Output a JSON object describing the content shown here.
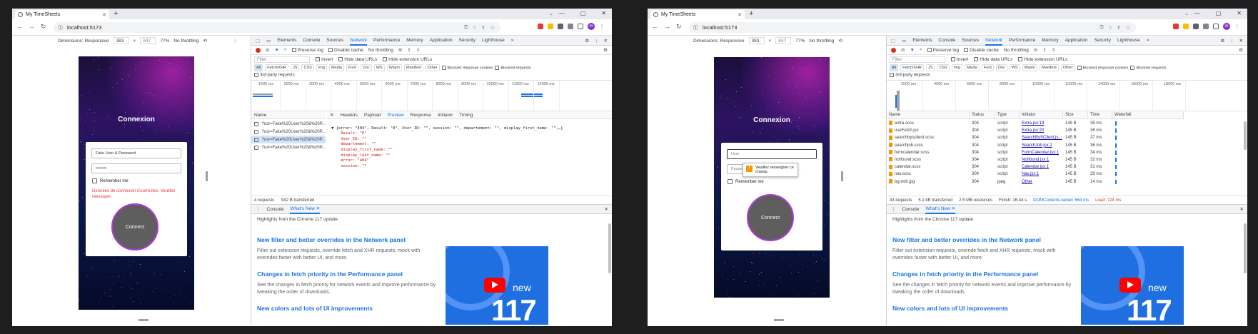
{
  "window_left": {
    "tab_title": "My TimeSheets",
    "url": "localhost:5173",
    "device": {
      "dimensions": "Dimensions: Responsive",
      "width": "383",
      "height": "847",
      "zoom": "77%",
      "throttle": "No throttling"
    },
    "login": {
      "title": "Connexion",
      "username_value": "Fake User & Password",
      "password_value": "••••••••",
      "remember_label": "Remember me",
      "error_text": "Données de connexion incorrectes. Veuillez réessayer.",
      "connect_label": "Connect"
    },
    "devtools": {
      "tabs": [
        "Elements",
        "Console",
        "Sources",
        "Network",
        "Performance",
        "Memory",
        "Application",
        "Security",
        "Lighthouse"
      ],
      "active_tab": "Network",
      "toolbar": {
        "preserve_log": "Preserve log",
        "disable_cache": "Disable cache",
        "throttle": "No throttling"
      },
      "filter_placeholder": "Filter",
      "invert": "Invert",
      "hide_data": "Hide data URLs",
      "hide_ext": "Hide extension URLs",
      "types": [
        "All",
        "Fetch/XHR",
        "JS",
        "CSS",
        "Img",
        "Media",
        "Font",
        "Doc",
        "WS",
        "Wasm",
        "Manifest",
        "Other"
      ],
      "blocked_cookies": "Blocked response cookies",
      "blocked_requests": "Blocked requests",
      "third_party": "3rd-party requests",
      "overview_ticks": [
        "1000 ms",
        "2000 ms",
        "3000 ms",
        "4000 ms",
        "5000 ms",
        "6000 ms",
        "7000 ms",
        "8000 ms",
        "9000 ms",
        "10000 ms",
        "11000 ms",
        "12000 ms"
      ],
      "name_header": "Name",
      "requests": [
        "?usr=Fake%20User%20&%20P...",
        "?usr=Fake%20User%20&%20P...",
        "?usr=Fake%20User%20&%20P...",
        "?usr=Fake%20User%20&%20P..."
      ],
      "panel_tabs": [
        "Headers",
        "Payload",
        "Preview",
        "Response",
        "Initiator",
        "Timing"
      ],
      "active_panel": "Preview",
      "preview_lines": [
        "▼ {error: \"404\", Result: \"0\", User_ID: \"\", session: \"\", departement: \"\", display_first_name: \"\",…}",
        "    Result: \"0\"",
        "    User_ID: \"\"",
        "    departement: \"\"",
        "    display_first_name: \"\"",
        "    display_last_name: \"\"",
        "    error: \"404\"",
        "    session: \"\""
      ],
      "status_requests": "4 requests",
      "status_transferred": "942 B transferred"
    },
    "drawer": {
      "tabs": [
        "Console",
        "What's New"
      ],
      "active": "What's New",
      "highlights": "Highlights from the Chrome 117 update",
      "items": [
        {
          "h": "New filter and better overrides in the Network panel",
          "p": "Filter out extension requests, override fetch and XHR requests, mock with overrides faster with better UI, and more."
        },
        {
          "h": "Changes in fetch priority in the Performance panel",
          "p": "See the changes in fetch priority for network events and improve performance by tweaking the order of downloads."
        },
        {
          "h": "New colors and lots of UI improvements",
          "p": ""
        }
      ],
      "video_new": "new",
      "video_num": "117"
    }
  },
  "window_right": {
    "tab_title": "My TimeSheets",
    "url": "localhost:5173",
    "device": {
      "dimensions": "Dimensions: Responsive",
      "width": "383",
      "height": "847",
      "zoom": "77%",
      "throttle": "No throttling"
    },
    "login": {
      "title": "Connexion",
      "username_placeholder": "User",
      "password_placeholder": "Passw",
      "tooltip": "Veuillez renseigner ce champ.",
      "remember_label": "Remember me",
      "connect_label": "Connect"
    },
    "devtools": {
      "overview_ticks": [
        "2000 ms",
        "4000 ms",
        "6000 ms",
        "8000 ms",
        "10000 ms",
        "12000 ms",
        "14000 ms",
        "16000 ms",
        "18000 ms"
      ],
      "columns": [
        "Name",
        "Status",
        "Type",
        "Initiator",
        "Size",
        "Time",
        "Waterfall"
      ],
      "rows": [
        {
          "name": "extra.scss",
          "status": "304",
          "type": "script",
          "initiator": "Extra.jsx:19",
          "size": "145 B",
          "time": "35 ms"
        },
        {
          "name": "useFetch.jsx",
          "status": "304",
          "type": "script",
          "initiator": "Extra.jsx:20",
          "size": "145 B",
          "time": "36 ms"
        },
        {
          "name": "searchbysclient.scss",
          "status": "304",
          "type": "script",
          "initiator": "SearchBySClient.js...",
          "size": "145 B",
          "time": "37 ms"
        },
        {
          "name": "searchjob.scss",
          "status": "304",
          "type": "script",
          "initiator": "SearchJob.jsx:2",
          "size": "145 B",
          "time": "36 ms"
        },
        {
          "name": "formcalendar.scss",
          "status": "304",
          "type": "script",
          "initiator": "FormCalendar.jsx:1",
          "size": "145 B",
          "time": "34 ms"
        },
        {
          "name": "notfound.scss",
          "status": "304",
          "type": "script",
          "initiator": "Notfound.jsx:1",
          "size": "145 B",
          "time": "32 ms"
        },
        {
          "name": "calendar.scss",
          "status": "304",
          "type": "script",
          "initiator": "Calendar.jsx:1",
          "size": "145 B",
          "time": "31 ms"
        },
        {
          "name": "nav.scss",
          "status": "304",
          "type": "script",
          "initiator": "Nav.jsx:1",
          "size": "145 B",
          "time": "29 ms"
        },
        {
          "name": "bg-mth.jpg",
          "status": "304",
          "type": "jpeg",
          "initiator": "Other",
          "size": "145 B",
          "time": "14 ms"
        }
      ],
      "status_requests": "43 requests",
      "status_transferred": "5.1 kB transferred",
      "status_resources": "2.5 MB resources",
      "status_finish": "Finish: 16.44 s",
      "status_dcl": "DOMContentLoaded: 663 ms",
      "status_load": "Load: 724 ms"
    }
  },
  "colors": {
    "accent": "#1a73e8",
    "error": "#e53935",
    "connect_border": "#b03ad8",
    "dcl": "#1a73e8",
    "load": "#d93025"
  }
}
